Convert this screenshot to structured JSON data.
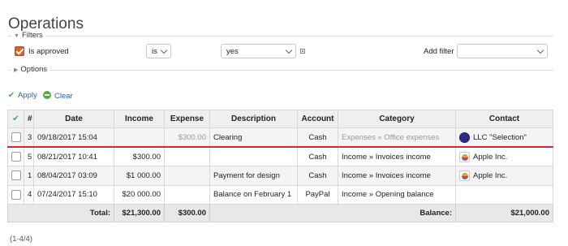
{
  "page": {
    "title": "Operations"
  },
  "filters": {
    "legend": "Filters",
    "approved_label": "Is approved",
    "operator": "is",
    "value": "yes",
    "add_filter_label": "Add filter",
    "add_filter_value": ""
  },
  "options": {
    "legend": "Options"
  },
  "actions": {
    "apply": "Apply",
    "clear": "Clear"
  },
  "table": {
    "headers": {
      "check": "✔",
      "num": "#",
      "date": "Date",
      "income": "Income",
      "expense": "Expense",
      "description": "Description",
      "account": "Account",
      "category": "Category",
      "contact": "Contact"
    },
    "rows": [
      {
        "num": "3",
        "date": "09/18/2017 15:04",
        "income": "",
        "expense": "$300.00",
        "description": "Clearing",
        "account": "Cash",
        "category": "Expenses » Office expenses",
        "contact": "LLC \"Selection\"",
        "icon": "company-logo-icon"
      },
      {
        "num": "5",
        "date": "08/21/2017 10:41",
        "income": "$300.00",
        "expense": "",
        "description": "",
        "account": "Cash",
        "category": "Income » Invoices income",
        "contact": "Apple Inc.",
        "icon": "apple-logo-icon"
      },
      {
        "num": "1",
        "date": "08/04/2017 03:09",
        "income": "$1 000.00",
        "expense": "",
        "description": "Payment for design",
        "account": "Cash",
        "category": "Income » Invoices income",
        "contact": "Apple Inc.",
        "icon": "apple-logo-icon"
      },
      {
        "num": "4",
        "date": "07/24/2017 15:10",
        "income": "$20 000.00",
        "expense": "",
        "description": "Balance on February 1",
        "account": "PayPal",
        "category": "Income » Opening balance",
        "contact": "",
        "icon": ""
      }
    ],
    "totals": {
      "label": "Total:",
      "income": "$21,300.00",
      "expense": "$300.00",
      "balance_label": "Balance:",
      "balance": "$21,000.00"
    }
  },
  "pager": {
    "text": "(1-4/4)"
  },
  "colors": {
    "accent_checkbox": "#d9602b",
    "link": "#2a62a8",
    "marker_line": "#d12a33",
    "header_bg": "#efefef"
  }
}
